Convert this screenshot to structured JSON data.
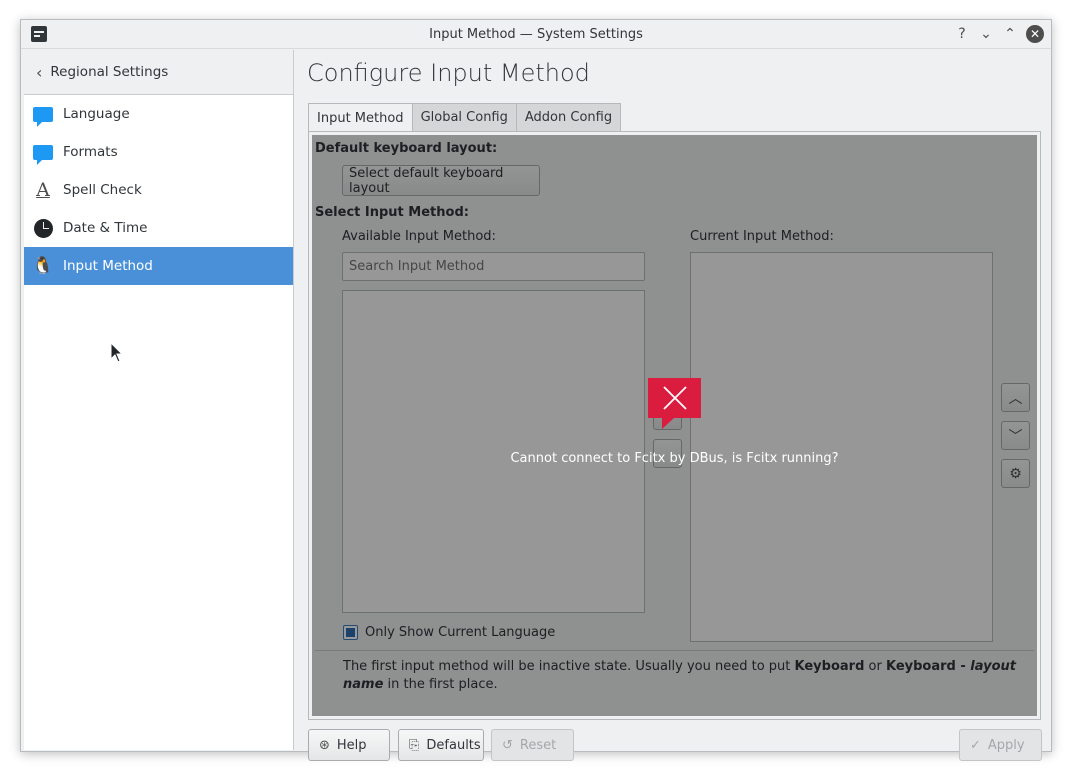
{
  "window": {
    "title": "Input Method — System Settings",
    "help_glyph": "?",
    "minimize_glyph": "⌄",
    "maximize_glyph": "⌃",
    "close_glyph": "✕"
  },
  "sidebar": {
    "back_label": "Regional Settings",
    "back_glyph": "‹",
    "items": [
      {
        "label": "Language",
        "icon": "speech-bubble-icon"
      },
      {
        "label": "Formats",
        "icon": "speech-bubble-icon"
      },
      {
        "label": "Spell Check",
        "icon": "letter-a-icon",
        "glyph": "A"
      },
      {
        "label": "Date & Time",
        "icon": "clock-icon"
      },
      {
        "label": "Input Method",
        "icon": "tux-penguin-icon",
        "glyph": "🐧",
        "selected": true
      }
    ]
  },
  "main": {
    "title": "Configure Input Method",
    "tabs": [
      {
        "label": "Input Method",
        "active": true
      },
      {
        "label": "Global Config",
        "active": false
      },
      {
        "label": "Addon Config",
        "active": false
      }
    ],
    "default_layout": {
      "label": "Default keyboard layout:",
      "button": "Select default keyboard layout"
    },
    "select_im": {
      "label": "Select Input Method:",
      "available_label": "Available Input Method:",
      "current_label": "Current Input Method:",
      "search_placeholder": "Search Input Method",
      "only_current_language": "Only Show Current Language",
      "move_up_glyph": "︿",
      "move_down_glyph": "﹀",
      "configure_glyph": "⚙"
    },
    "footnote": {
      "text1": "The first input method will be inactive state. Usually you need to put ",
      "bold1": "Keyboard",
      "text2": " or ",
      "bold2": "Keyboard - ",
      "italic": "layout name",
      "text3": " in the first place."
    },
    "error": {
      "message": "Cannot connect to Fcitx by DBus, is Fcitx running?",
      "icon_glyph": "✕",
      "color": "#da1c3f"
    }
  },
  "footer": {
    "help": "Help",
    "help_glyph": "⊛",
    "defaults": "Defaults",
    "defaults_glyph": "⎘",
    "reset": "Reset",
    "reset_glyph": "↺",
    "apply": "Apply",
    "apply_glyph": "✓"
  },
  "colors": {
    "selection": "#4a90d9",
    "window_bg": "#eff0f1"
  }
}
